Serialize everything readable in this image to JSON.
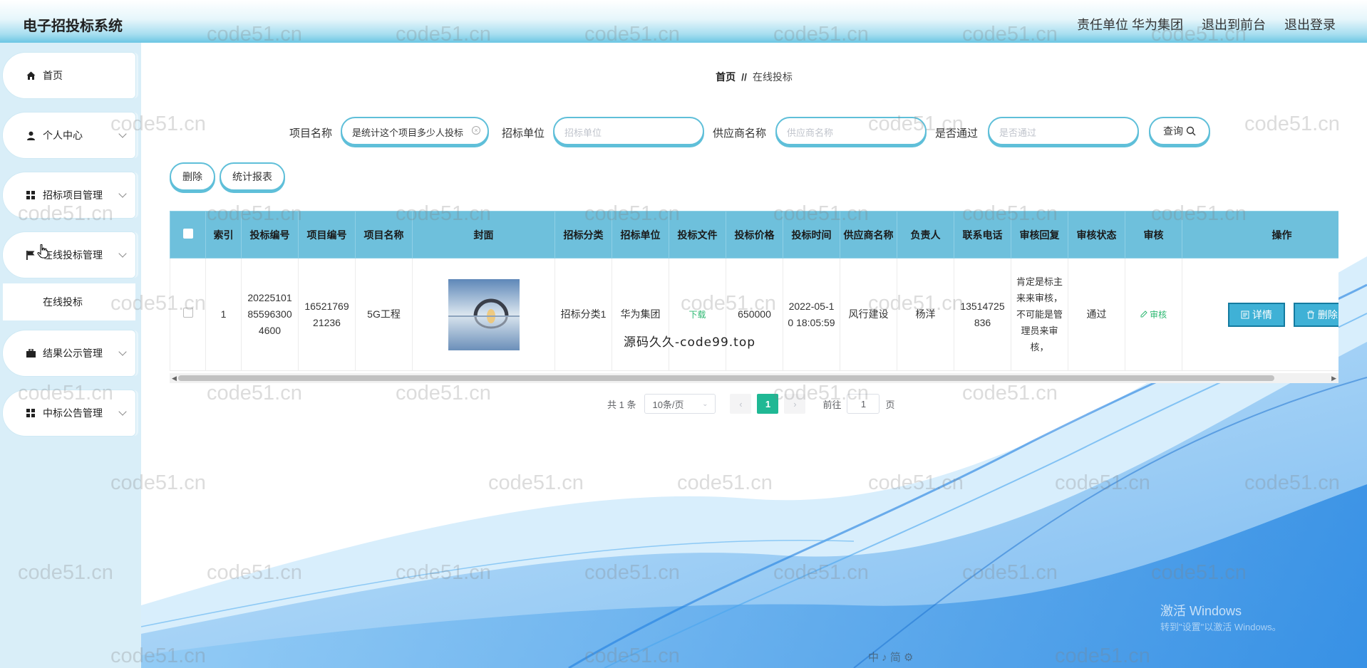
{
  "app": {
    "title": "电子招投标系统"
  },
  "header": {
    "unit_label": "责任单位 华为集团",
    "to_front": "退出到前台",
    "logout": "退出登录"
  },
  "sidebar": {
    "items": [
      {
        "label": "首页",
        "icon": "home-icon"
      },
      {
        "label": "个人中心",
        "icon": "user-icon"
      },
      {
        "label": "招标项目管理",
        "icon": "grid-icon"
      },
      {
        "label": "在线投标管理",
        "icon": "flag-icon"
      },
      {
        "label": "在线投标",
        "icon": ""
      },
      {
        "label": "结果公示管理",
        "icon": "briefcase-icon"
      },
      {
        "label": "中标公告管理",
        "icon": "grid-icon"
      }
    ]
  },
  "breadcrumb": {
    "home": "首页",
    "sep": "//",
    "current": "在线投标"
  },
  "search": {
    "project_name_label": "项目名称",
    "project_name_value": "是统计这个项目多少人投标",
    "bid_unit_label": "招标单位",
    "bid_unit_placeholder": "招标单位",
    "supplier_label": "供应商名称",
    "supplier_placeholder": "供应商名称",
    "passed_label": "是否通过",
    "passed_placeholder": "是否通过",
    "query_button": "查询"
  },
  "toolbar": {
    "delete": "删除",
    "report": "统计报表"
  },
  "table": {
    "columns": [
      "索引",
      "投标编号",
      "项目编号",
      "项目名称",
      "封面",
      "招标分类",
      "招标单位",
      "投标文件",
      "投标价格",
      "投标时间",
      "供应商名称",
      "负责人",
      "联系电话",
      "审核回复",
      "审核状态",
      "审核",
      "操作"
    ],
    "rows": [
      {
        "index": "1",
        "bid_no": "20225101855963004600",
        "project_no": "1652176921236",
        "project_name": "5G工程",
        "category": "招标分类1",
        "unit": "华为集团",
        "file": "下载",
        "price": "650000",
        "time": "2022-05-10 18:05:59",
        "supplier": "风行建设",
        "owner": "杨洋",
        "phone": "13514725836",
        "reply": "肯定是标主来来审核，不可能是管理员来审核，",
        "status": "通过",
        "audit": "审核",
        "detail": "详情",
        "delete": "删除"
      }
    ]
  },
  "pager": {
    "total": "共 1 条",
    "page_size": "10条/页",
    "current_page": "1",
    "goto_prefix": "前往",
    "goto_value": "1",
    "goto_suffix": "页"
  },
  "watermarks": {
    "site": "code51.cn",
    "source": "源码久久-code99.top"
  },
  "os_overlay": {
    "activate": "激活 Windows",
    "activate_hint": "转到\"设置\"以激活 Windows。",
    "tray": "中 ♪ 简 ⚙"
  }
}
